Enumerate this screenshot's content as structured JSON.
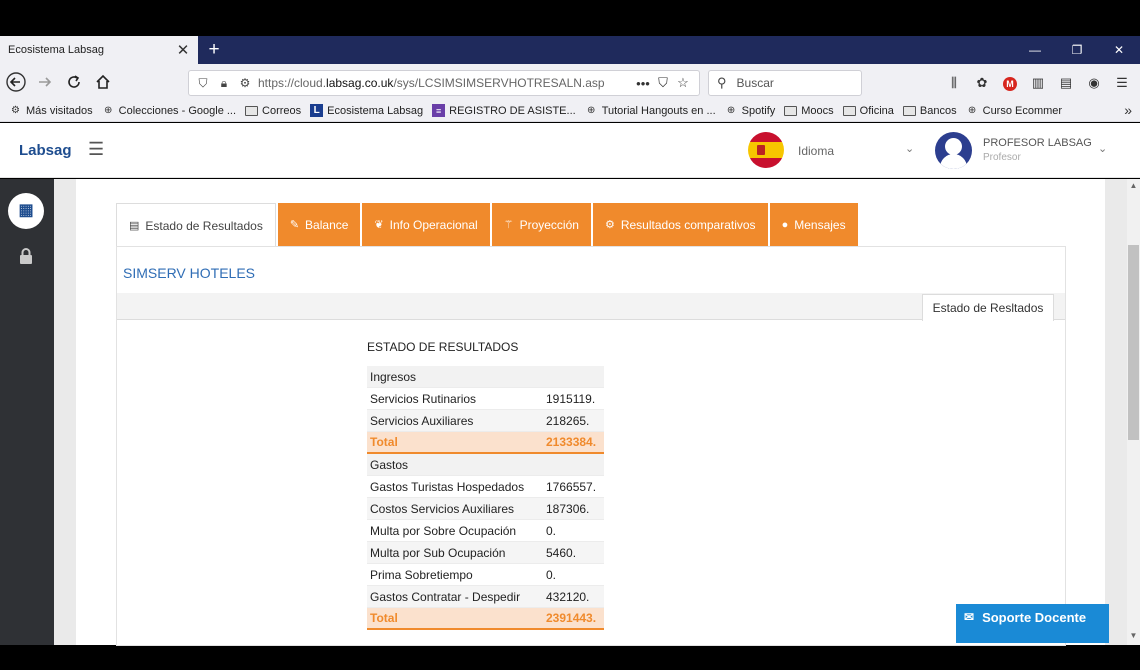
{
  "browser": {
    "tab_title": "Ecosistema Labsag",
    "tab_close": "✕",
    "new_tab": "+",
    "url_host_prefix": "https://cloud.",
    "url_host": "labsag.co.uk",
    "url_path": "/sys/LCSIMSIMSERVHOTRESALN.asp",
    "search_placeholder": "Buscar",
    "bookmarks": [
      {
        "label": "Más visitados",
        "icon": "gear-icon"
      },
      {
        "label": "Colecciones - Google ...",
        "icon": "globe-icon"
      },
      {
        "label": "Correos",
        "icon": "folder-icon"
      },
      {
        "label": "Ecosistema Labsag",
        "icon": "labsag-icon"
      },
      {
        "label": "REGISTRO DE ASISTE...",
        "icon": "form-icon"
      },
      {
        "label": "Tutorial Hangouts en ...",
        "icon": "globe-icon"
      },
      {
        "label": "Spotify",
        "icon": "globe-icon"
      },
      {
        "label": "Moocs",
        "icon": "folder-icon"
      },
      {
        "label": "Oficina",
        "icon": "folder-icon"
      },
      {
        "label": "Bancos",
        "icon": "folder-icon"
      },
      {
        "label": "Curso Ecommer",
        "icon": "globe-icon"
      }
    ]
  },
  "header": {
    "brand": "Labsag",
    "language_label": "Idioma",
    "user_name": "PROFESOR LABSAG",
    "user_role": "Profesor"
  },
  "tabs": [
    {
      "label": "Estado de Resultados",
      "icon": "document-icon",
      "active": true
    },
    {
      "label": "Balance",
      "icon": "tag-icon",
      "active": false
    },
    {
      "label": "Info Operacional",
      "icon": "leaf-icon",
      "active": false
    },
    {
      "label": "Proyección",
      "icon": "wand-icon",
      "active": false
    },
    {
      "label": "Resultados comparativos",
      "icon": "cogs-icon",
      "active": false
    },
    {
      "label": "Mensajes",
      "icon": "chat-icon",
      "active": false
    }
  ],
  "company_name": "SIMSERV HOTELES",
  "subtab_label": "Estado de Resltados",
  "report": {
    "title": "ESTADO DE RESULTADOS",
    "rows": [
      {
        "label": "Ingresos",
        "value": "",
        "type": "section"
      },
      {
        "label": "Servicios Rutinarios",
        "value": "1915119.",
        "type": "item"
      },
      {
        "label": "Servicios Auxiliares",
        "value": "218265.",
        "type": "item"
      },
      {
        "label": "Total",
        "value": "2133384.",
        "type": "total"
      },
      {
        "label": "Gastos",
        "value": "",
        "type": "section"
      },
      {
        "label": "Gastos Turistas Hospedados",
        "value": "1766557.",
        "type": "item"
      },
      {
        "label": "Costos Servicios Auxiliares",
        "value": "187306.",
        "type": "item"
      },
      {
        "label": "Multa por Sobre Ocupación",
        "value": "0.",
        "type": "item"
      },
      {
        "label": "Multa por Sub Ocupación",
        "value": "5460.",
        "type": "item"
      },
      {
        "label": "Prima Sobretiempo",
        "value": "0.",
        "type": "item"
      },
      {
        "label": "Gastos Contratar - Despedir",
        "value": "432120.",
        "type": "item"
      },
      {
        "label": "Total",
        "value": "2391443.",
        "type": "total"
      }
    ]
  },
  "support_button": "Soporte Docente",
  "colors": {
    "accent_orange": "#f08a2c",
    "brand_blue": "#1e4d8f",
    "link_blue": "#2f6db5",
    "support_blue": "#1a8ad6"
  }
}
